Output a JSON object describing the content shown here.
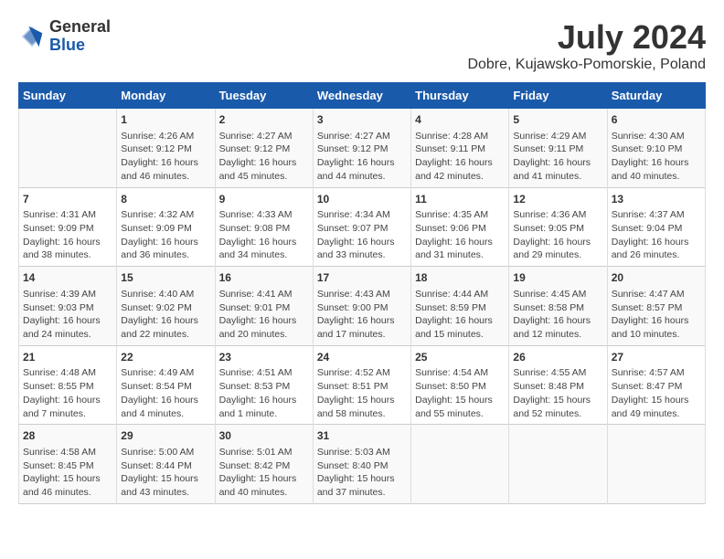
{
  "header": {
    "logo_general": "General",
    "logo_blue": "Blue",
    "month_title": "July 2024",
    "location": "Dobre, Kujawsko-Pomorskie, Poland"
  },
  "columns": [
    "Sunday",
    "Monday",
    "Tuesday",
    "Wednesday",
    "Thursday",
    "Friday",
    "Saturday"
  ],
  "weeks": [
    {
      "days": [
        {
          "num": "",
          "content": ""
        },
        {
          "num": "1",
          "content": "Sunrise: 4:26 AM\nSunset: 9:12 PM\nDaylight: 16 hours\nand 46 minutes."
        },
        {
          "num": "2",
          "content": "Sunrise: 4:27 AM\nSunset: 9:12 PM\nDaylight: 16 hours\nand 45 minutes."
        },
        {
          "num": "3",
          "content": "Sunrise: 4:27 AM\nSunset: 9:12 PM\nDaylight: 16 hours\nand 44 minutes."
        },
        {
          "num": "4",
          "content": "Sunrise: 4:28 AM\nSunset: 9:11 PM\nDaylight: 16 hours\nand 42 minutes."
        },
        {
          "num": "5",
          "content": "Sunrise: 4:29 AM\nSunset: 9:11 PM\nDaylight: 16 hours\nand 41 minutes."
        },
        {
          "num": "6",
          "content": "Sunrise: 4:30 AM\nSunset: 9:10 PM\nDaylight: 16 hours\nand 40 minutes."
        }
      ]
    },
    {
      "days": [
        {
          "num": "7",
          "content": "Sunrise: 4:31 AM\nSunset: 9:09 PM\nDaylight: 16 hours\nand 38 minutes."
        },
        {
          "num": "8",
          "content": "Sunrise: 4:32 AM\nSunset: 9:09 PM\nDaylight: 16 hours\nand 36 minutes."
        },
        {
          "num": "9",
          "content": "Sunrise: 4:33 AM\nSunset: 9:08 PM\nDaylight: 16 hours\nand 34 minutes."
        },
        {
          "num": "10",
          "content": "Sunrise: 4:34 AM\nSunset: 9:07 PM\nDaylight: 16 hours\nand 33 minutes."
        },
        {
          "num": "11",
          "content": "Sunrise: 4:35 AM\nSunset: 9:06 PM\nDaylight: 16 hours\nand 31 minutes."
        },
        {
          "num": "12",
          "content": "Sunrise: 4:36 AM\nSunset: 9:05 PM\nDaylight: 16 hours\nand 29 minutes."
        },
        {
          "num": "13",
          "content": "Sunrise: 4:37 AM\nSunset: 9:04 PM\nDaylight: 16 hours\nand 26 minutes."
        }
      ]
    },
    {
      "days": [
        {
          "num": "14",
          "content": "Sunrise: 4:39 AM\nSunset: 9:03 PM\nDaylight: 16 hours\nand 24 minutes."
        },
        {
          "num": "15",
          "content": "Sunrise: 4:40 AM\nSunset: 9:02 PM\nDaylight: 16 hours\nand 22 minutes."
        },
        {
          "num": "16",
          "content": "Sunrise: 4:41 AM\nSunset: 9:01 PM\nDaylight: 16 hours\nand 20 minutes."
        },
        {
          "num": "17",
          "content": "Sunrise: 4:43 AM\nSunset: 9:00 PM\nDaylight: 16 hours\nand 17 minutes."
        },
        {
          "num": "18",
          "content": "Sunrise: 4:44 AM\nSunset: 8:59 PM\nDaylight: 16 hours\nand 15 minutes."
        },
        {
          "num": "19",
          "content": "Sunrise: 4:45 AM\nSunset: 8:58 PM\nDaylight: 16 hours\nand 12 minutes."
        },
        {
          "num": "20",
          "content": "Sunrise: 4:47 AM\nSunset: 8:57 PM\nDaylight: 16 hours\nand 10 minutes."
        }
      ]
    },
    {
      "days": [
        {
          "num": "21",
          "content": "Sunrise: 4:48 AM\nSunset: 8:55 PM\nDaylight: 16 hours\nand 7 minutes."
        },
        {
          "num": "22",
          "content": "Sunrise: 4:49 AM\nSunset: 8:54 PM\nDaylight: 16 hours\nand 4 minutes."
        },
        {
          "num": "23",
          "content": "Sunrise: 4:51 AM\nSunset: 8:53 PM\nDaylight: 16 hours\nand 1 minute."
        },
        {
          "num": "24",
          "content": "Sunrise: 4:52 AM\nSunset: 8:51 PM\nDaylight: 15 hours\nand 58 minutes."
        },
        {
          "num": "25",
          "content": "Sunrise: 4:54 AM\nSunset: 8:50 PM\nDaylight: 15 hours\nand 55 minutes."
        },
        {
          "num": "26",
          "content": "Sunrise: 4:55 AM\nSunset: 8:48 PM\nDaylight: 15 hours\nand 52 minutes."
        },
        {
          "num": "27",
          "content": "Sunrise: 4:57 AM\nSunset: 8:47 PM\nDaylight: 15 hours\nand 49 minutes."
        }
      ]
    },
    {
      "days": [
        {
          "num": "28",
          "content": "Sunrise: 4:58 AM\nSunset: 8:45 PM\nDaylight: 15 hours\nand 46 minutes."
        },
        {
          "num": "29",
          "content": "Sunrise: 5:00 AM\nSunset: 8:44 PM\nDaylight: 15 hours\nand 43 minutes."
        },
        {
          "num": "30",
          "content": "Sunrise: 5:01 AM\nSunset: 8:42 PM\nDaylight: 15 hours\nand 40 minutes."
        },
        {
          "num": "31",
          "content": "Sunrise: 5:03 AM\nSunset: 8:40 PM\nDaylight: 15 hours\nand 37 minutes."
        },
        {
          "num": "",
          "content": ""
        },
        {
          "num": "",
          "content": ""
        },
        {
          "num": "",
          "content": ""
        }
      ]
    }
  ]
}
